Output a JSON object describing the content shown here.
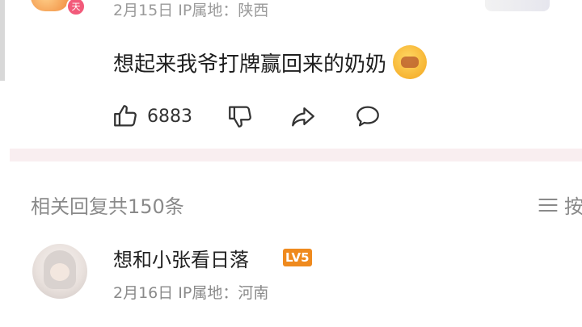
{
  "top_comment": {
    "meta": "2月15日 IP属地：陕西",
    "avatar_badge": "天",
    "text": "想起来我爷打牌赢回来的奶奶",
    "emoji_icon": "facepalm-emoji",
    "like_count": "6883"
  },
  "replies": {
    "label": "相关回复共150条",
    "sort_label": "按"
  },
  "reply_item": {
    "username": "想和小张看日落",
    "level": "LV5",
    "meta": "2月16日 IP属地：河南"
  },
  "colors": {
    "divider": "#f9eef0",
    "level_badge": "#ef8a1e",
    "muted_text": "#8a8a8a"
  }
}
